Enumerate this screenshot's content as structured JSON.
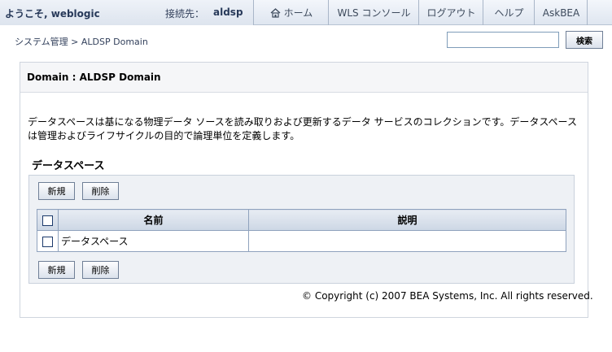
{
  "header": {
    "welcome": "ようこそ, weblogic",
    "connection_label": "接続先：",
    "connection_domain": "aldsp",
    "nav": {
      "home": "ホーム",
      "wls_console": "WLS コンソール",
      "logout": "ログアウト",
      "help": "ヘルプ",
      "askbea": "AskBEA"
    }
  },
  "breadcrumb": "システム管理 > ALDSP Domain",
  "search": {
    "value": "",
    "button_label": "検索"
  },
  "panel": {
    "title": "Domain : ALDSP Domain",
    "description": "データスペースは基になる物理データ ソースを読み取りおよび更新するデータ サービスのコレクションです。データスペースは管理およびライフサイクルの目的で論理単位を定義します。",
    "section_title": "データスペース",
    "buttons": {
      "new": "新規",
      "delete": "削除"
    },
    "table": {
      "columns": [
        "名前",
        "説明"
      ],
      "rows": [
        {
          "name": "データスペース",
          "description": ""
        }
      ]
    },
    "copyright": "© Copyright (c) 2007 BEA Systems, Inc. All rights reserved."
  }
}
